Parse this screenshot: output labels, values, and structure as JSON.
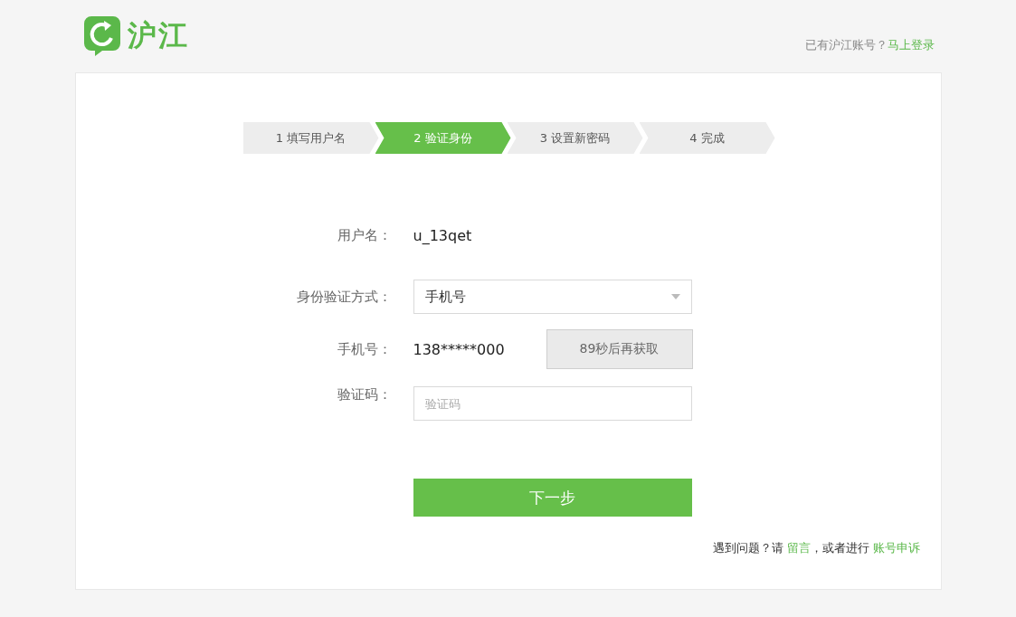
{
  "header": {
    "logo_text": "沪江",
    "login_prompt": "已有沪江账号？",
    "login_link": "马上登录"
  },
  "steps": [
    {
      "label": "1 填写用户名",
      "selected": false
    },
    {
      "label": "2 验证身份",
      "selected": true
    },
    {
      "label": "3 设置新密码",
      "selected": false
    },
    {
      "label": "4 完成",
      "selected": false
    }
  ],
  "form": {
    "rows": [
      {
        "kind": "text",
        "label": "用户名：",
        "value": "u_13qet"
      },
      {
        "kind": "select",
        "label": "身份验证方式：",
        "value": "手机号"
      },
      {
        "kind": "phone",
        "label": "手机号：",
        "value": "138*****000",
        "button": "89秒后再获取"
      },
      {
        "kind": "input",
        "label": "验证码：",
        "placeholder": "验证码"
      }
    ],
    "submit": "下一步"
  },
  "help": {
    "prefix": "遇到问题？请 ",
    "link1": "留言",
    "middle": "，或者进行 ",
    "link2": "账号申诉"
  }
}
